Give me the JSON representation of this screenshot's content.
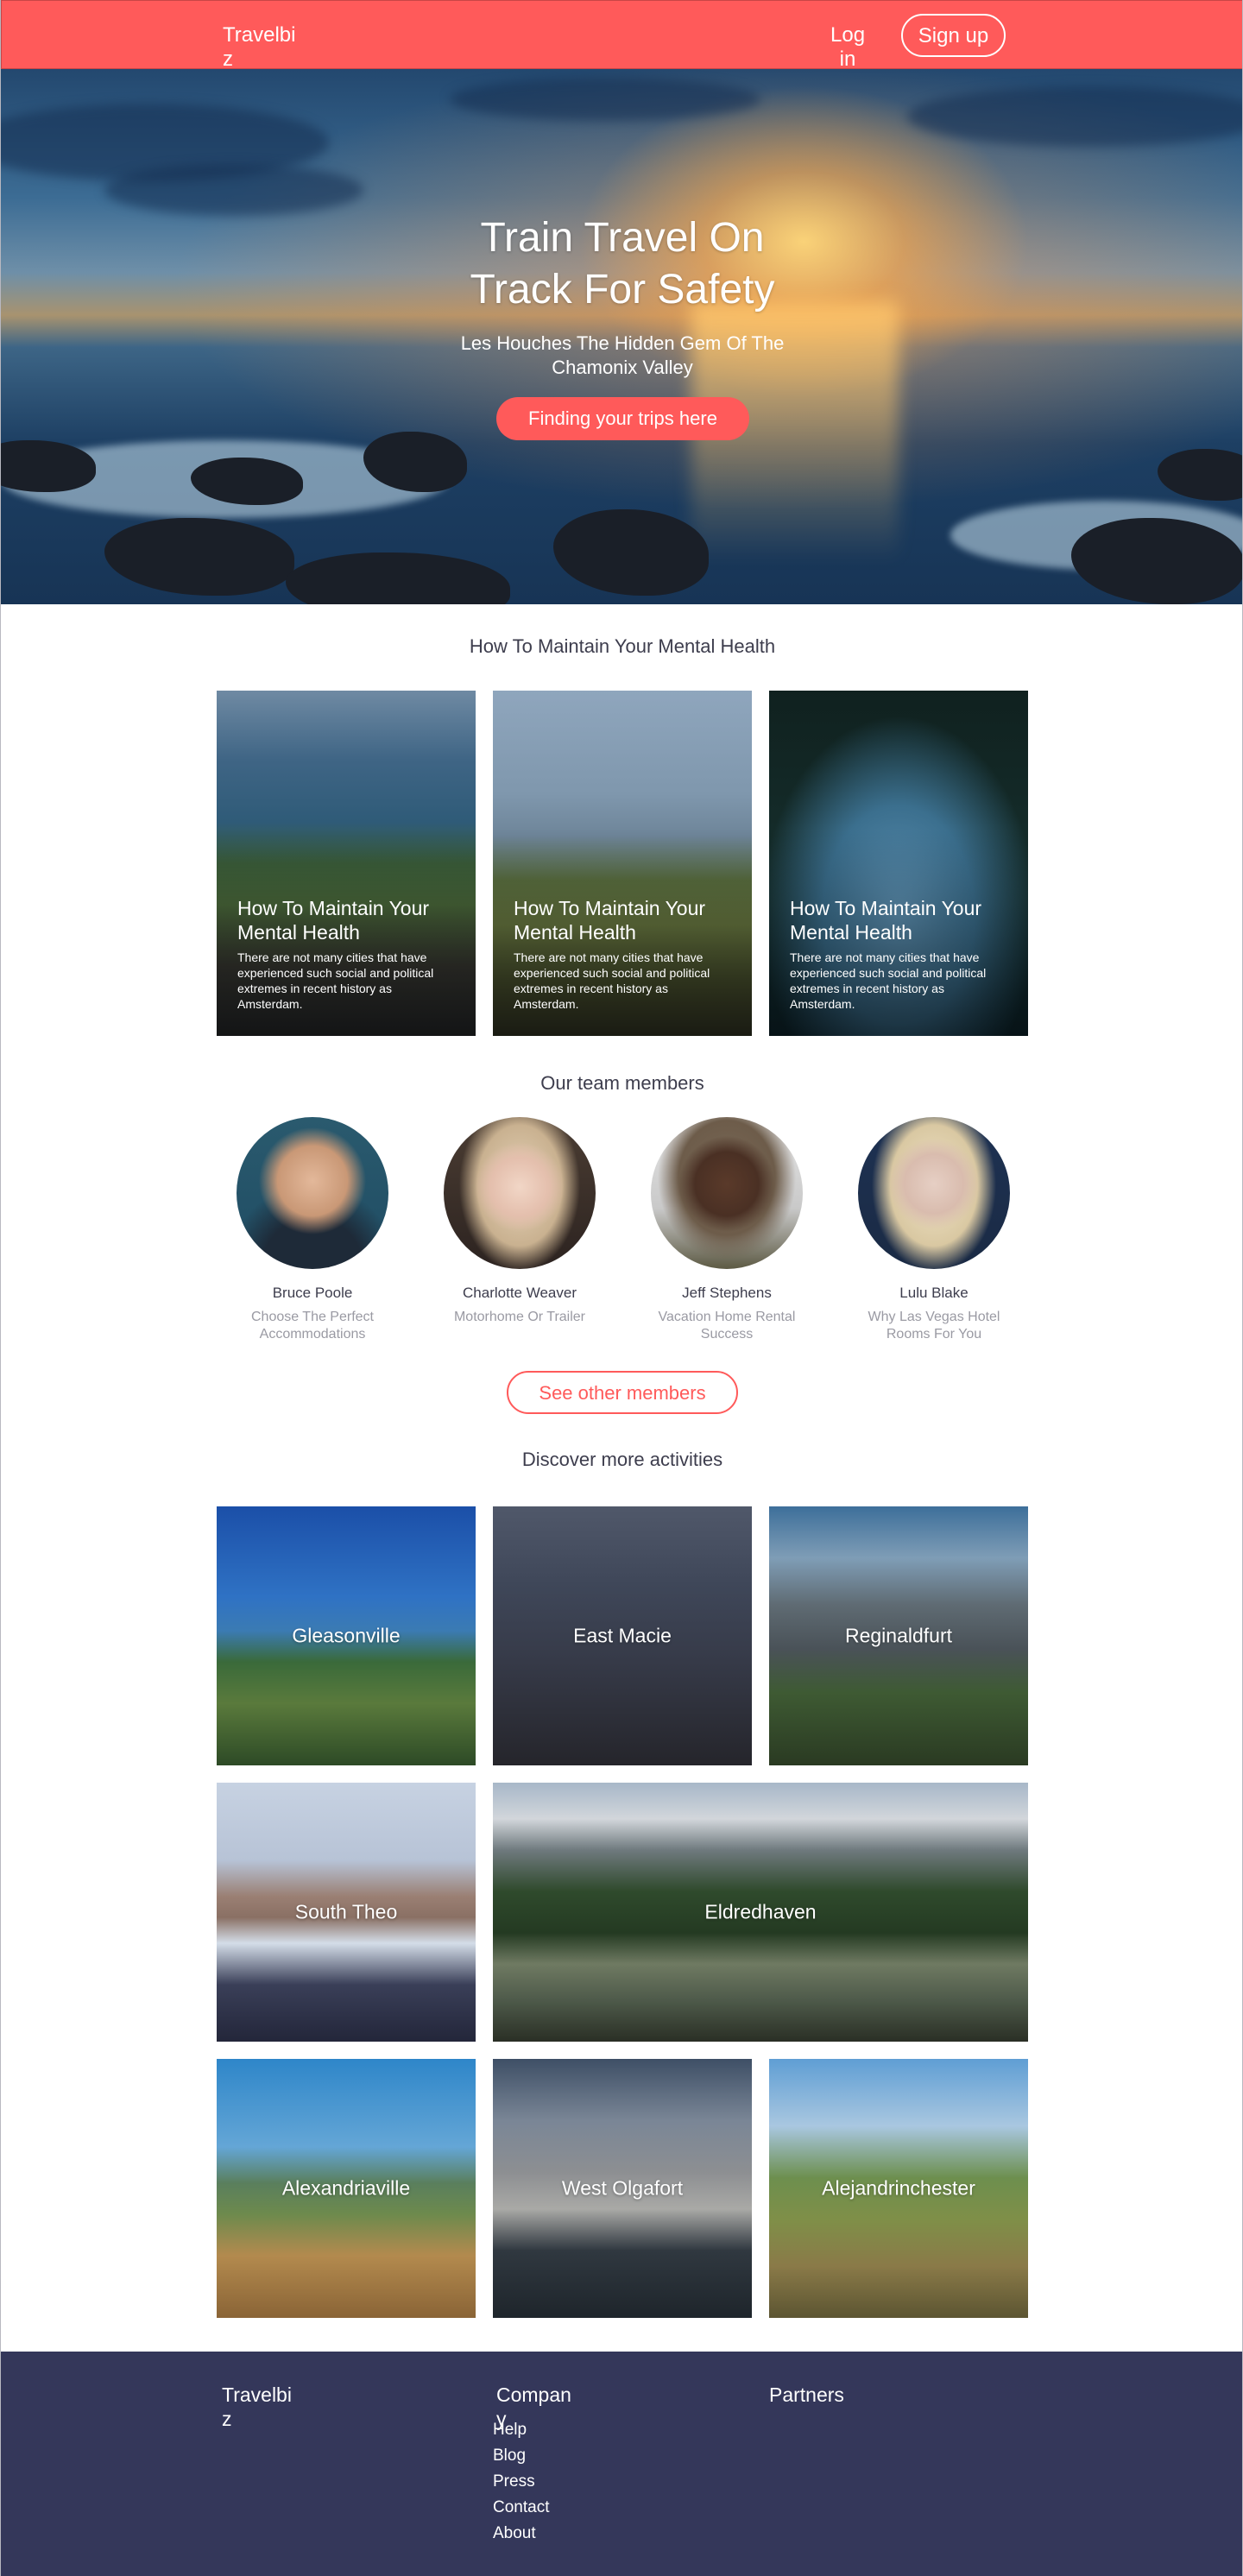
{
  "header": {
    "brand": "Travelbiz",
    "login_label": "Log in",
    "signup_label": "Sign up"
  },
  "hero": {
    "title": "Train Travel On Track For Safety",
    "subtitle": "Les Houches The Hidden Gem Of The Chamonix Valley",
    "cta_label": "Finding your trips here"
  },
  "articles": {
    "heading": "How To Maintain Your Mental Health",
    "cards": [
      {
        "title": "How To Maintain Your Mental Health",
        "text": "There are not many cities that have experienced such social and political extremes in recent history as Amsterdam."
      },
      {
        "title": "How To Maintain Your Mental Health",
        "text": "There are not many cities that have experienced such social and political extremes in recent history as Amsterdam."
      },
      {
        "title": "How To Maintain Your Mental Health",
        "text": "There are not many cities that have experienced such social and political extremes in recent history as Amsterdam."
      }
    ]
  },
  "team": {
    "heading": "Our team members",
    "members": [
      {
        "name": "Bruce Poole",
        "role": "Choose The Perfect Accommodations"
      },
      {
        "name": "Charlotte Weaver",
        "role": "Motorhome Or Trailer"
      },
      {
        "name": "Jeff Stephens",
        "role": "Vacation Home Rental Success"
      },
      {
        "name": "Lulu Blake",
        "role": "Why Las Vegas Hotel Rooms For You"
      }
    ],
    "more_label": "See other members"
  },
  "activities": {
    "heading": "Discover more activities",
    "places": [
      "Gleasonville",
      "East Macie",
      "Reginaldfurt",
      "South Theo",
      "Eldredhaven",
      "Alexandriaville",
      "West Olgafort",
      "Alejandrinchester"
    ]
  },
  "footer": {
    "brand": "Travelbiz",
    "company_title": "Company",
    "partners_title": "Partners",
    "links": [
      "Help",
      "Blog",
      "Press",
      "Contact",
      "About"
    ]
  },
  "colors": {
    "accent": "#ff5a5a",
    "footer_bg": "#34375a"
  }
}
